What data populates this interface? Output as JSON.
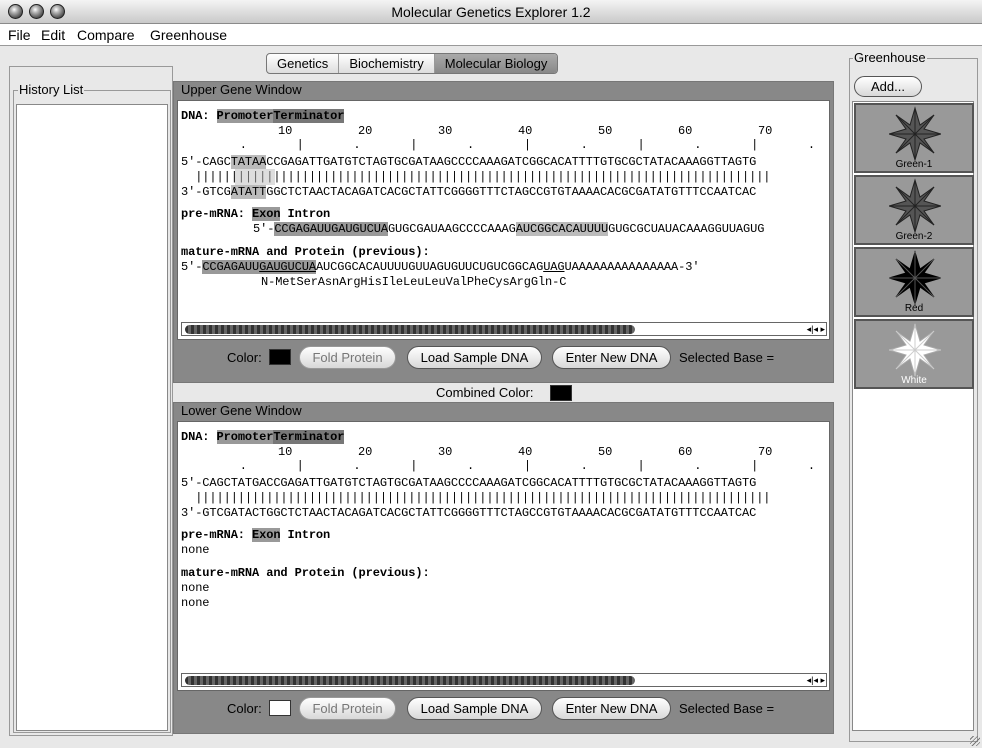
{
  "window": {
    "title": "Molecular Genetics Explorer 1.2"
  },
  "menu": [
    "File",
    "Edit",
    "Compare",
    "Greenhouse"
  ],
  "tabs": [
    {
      "label": "Genetics"
    },
    {
      "label": "Biochemistry"
    },
    {
      "label": "Molecular Biology",
      "selected": true
    }
  ],
  "history": {
    "title": "History List"
  },
  "upper": {
    "title": "Upper Gene Window",
    "dna_label": "DNA: ",
    "promoter": "Promoter",
    "terminator": "Terminator",
    "ruler_nums": [
      "10",
      "20",
      "30",
      "40",
      "50",
      "60",
      "70"
    ],
    "ruler_marks": "        .       |       .       |       .       |       .       |       .       |       .       |       .       |       .",
    "top_prefix": "5'-CAGC",
    "top_box": "TATAA",
    "top_rest": "CCGAGATTGATGTCTAGTGCGATAAGCCCCAAAGATCGGCACATTTTGTGCGCTATACAAAGGTTAGTG",
    "bars": "  |||||||||||||||||||||||||||||||||||||||||||||||||||||||||||||||||||||||||||||||||",
    "bottom_prefix": "3'-GTCG",
    "bottom_box": "ATATT",
    "bottom_rest": "GGCTCTAACTACAGATCACGCTATTCGGGGTTTCTAGCCGTGTAAAACACGCGATATGTTTCCAATCAC",
    "premrna_label": "pre-mRNA: ",
    "exon": "Exon",
    "intron": " Intron",
    "premrna_prefix": "5'-",
    "premrna_exon1": "CCGAGAUUGAUGUCUA",
    "premrna_mid": "GUGCGAUAAGCCCCAAAG",
    "premrna_exon2": "AUCGGCACAUUUU",
    "premrna_rest": "GUGCGCUAUACAAAGGUUAGUG",
    "mature_label": "mature-mRNA and Protein (previous):",
    "mature_prefix": "5'-",
    "mature_hl1": "CCGAGAUU",
    "mature_hl2": "GAUGUCUA",
    "mature_mid": "AUCGGCACAUUUUGUUAGUGUUCUGUCGGCAG",
    "mature_stop": "UAG",
    "mature_rest": "UAAAAAAAAAAAAAAA-3'",
    "protein": "N-MetSerAsnArgHisIleLeuLeuValPheCysArgGln-C",
    "color_label": "Color:",
    "color": "#000000",
    "fold_label": "Fold Protein",
    "load_label": "Load Sample DNA",
    "enter_label": "Enter New DNA",
    "selected_label": "Selected Base ="
  },
  "combined": {
    "label": "Combined Color:",
    "color": "#000000"
  },
  "lower": {
    "title": "Lower Gene Window",
    "dna_label": "DNA: ",
    "promoter": "Promoter",
    "terminator": "Terminator",
    "ruler_nums": [
      "10",
      "20",
      "30",
      "40",
      "50",
      "60",
      "70"
    ],
    "ruler_marks": "        .       |       .       |       .       |       .       |       .       |       .       |       .       |       .",
    "top_seq": "5'-CAGCTATGACCGAGATTGATGTCTAGTGCGATAAGCCCCAAAGATCGGCACATTTTGTGCGCTATACAAAGGTTAGTG",
    "bars": "  |||||||||||||||||||||||||||||||||||||||||||||||||||||||||||||||||||||||||||||||||",
    "bottom_seq": "3'-GTCGATACTGGCTCTAACTACAGATCACGCTATTCGGGGTTTCTAGCCGTGTAAAACACGCGATATGTTTCCAATCAC",
    "premrna_label": "pre-mRNA: ",
    "exon": "Exon",
    "intron": " Intron",
    "premrna_value": "none",
    "mature_label": "mature-mRNA and Protein (previous):",
    "mature_value": "none",
    "protein_value": "none",
    "color_label": "Color:",
    "color": "#ffffff",
    "fold_label": "Fold Protein",
    "load_label": "Load Sample DNA",
    "enter_label": "Enter New DNA",
    "selected_label": "Selected Base ="
  },
  "greenhouse": {
    "title": "Greenhouse",
    "add_label": "Add...",
    "plants": [
      {
        "name": "Green-1",
        "color": "#555555"
      },
      {
        "name": "Green-2",
        "color": "#555555"
      },
      {
        "name": "Red",
        "color": "#000000"
      },
      {
        "name": "White",
        "color": "#ffffff"
      }
    ]
  }
}
